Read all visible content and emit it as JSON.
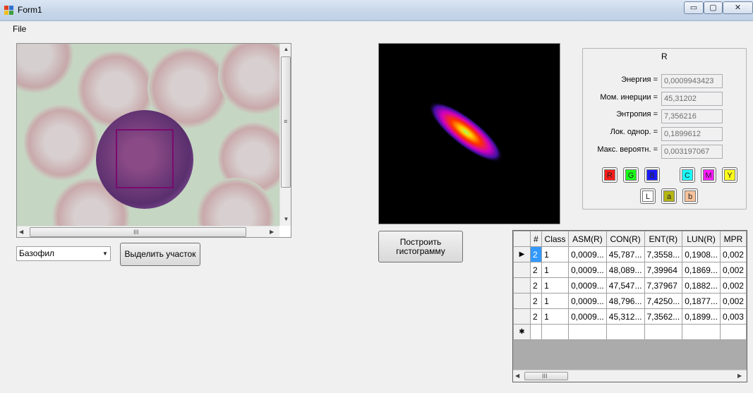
{
  "window": {
    "title": "Form1",
    "minimize": "▭",
    "maximize": "▢",
    "close": "✕"
  },
  "menu": {
    "file": "File"
  },
  "controls": {
    "cell_type": "Базофил",
    "select_region_label": "Выделить участок",
    "build_histogram_label": "Построить гистограмму"
  },
  "features": {
    "title": "R",
    "rows": [
      {
        "label": "Энергия =",
        "value": "0,0009943423"
      },
      {
        "label": "Мом. инерции =",
        "value": "45,31202"
      },
      {
        "label": "Энтропия =",
        "value": "7,356216"
      },
      {
        "label": "Лок. однор. =",
        "value": "0,1899612"
      },
      {
        "label": "Макс. вероятн. =",
        "value": "0,003197067"
      }
    ],
    "channels": [
      {
        "label": "R",
        "color": "#ff1a1a"
      },
      {
        "label": "G",
        "color": "#1aff1a"
      },
      {
        "label": "B",
        "color": "#1a1aff"
      },
      {
        "label": "C",
        "color": "#1affff"
      },
      {
        "label": "M",
        "color": "#ff1aff"
      },
      {
        "label": "Y",
        "color": "#ffff1a"
      },
      {
        "label": "L",
        "color": "#ffffff"
      },
      {
        "label": "a",
        "color": "#b5b515"
      },
      {
        "label": "b",
        "color": "#f7c29b"
      }
    ]
  },
  "grid": {
    "columns": [
      "#",
      "Class",
      "ASM(R)",
      "CON(R)",
      "ENT(R)",
      "LUN(R)",
      "MPR"
    ],
    "rows": [
      [
        "2",
        "1",
        "0,0009...",
        "45,787...",
        "7,3558...",
        "0,1908...",
        "0,002"
      ],
      [
        "2",
        "1",
        "0,0009...",
        "48,089...",
        "7,39964",
        "0,1869...",
        "0,002"
      ],
      [
        "2",
        "1",
        "0,0009...",
        "47,547...",
        "7,37967",
        "0,1882...",
        "0,002"
      ],
      [
        "2",
        "1",
        "0,0009...",
        "48,796...",
        "7,4250...",
        "0,1877...",
        "0,002"
      ],
      [
        "2",
        "1",
        "0,0009...",
        "45,312...",
        "7,3562...",
        "0,1899...",
        "0,003"
      ]
    ],
    "current_marker": "▶",
    "new_row_marker": "✱"
  },
  "icons": {
    "scroll_up": "▲",
    "scroll_down": "▼",
    "scroll_left": "◀",
    "scroll_right": "▶",
    "grip_v": "≡",
    "grip_h": "III",
    "dropdown": "▼"
  },
  "colors": {
    "selection": "#7a0a6e",
    "grid_selected": "#3399ff"
  }
}
